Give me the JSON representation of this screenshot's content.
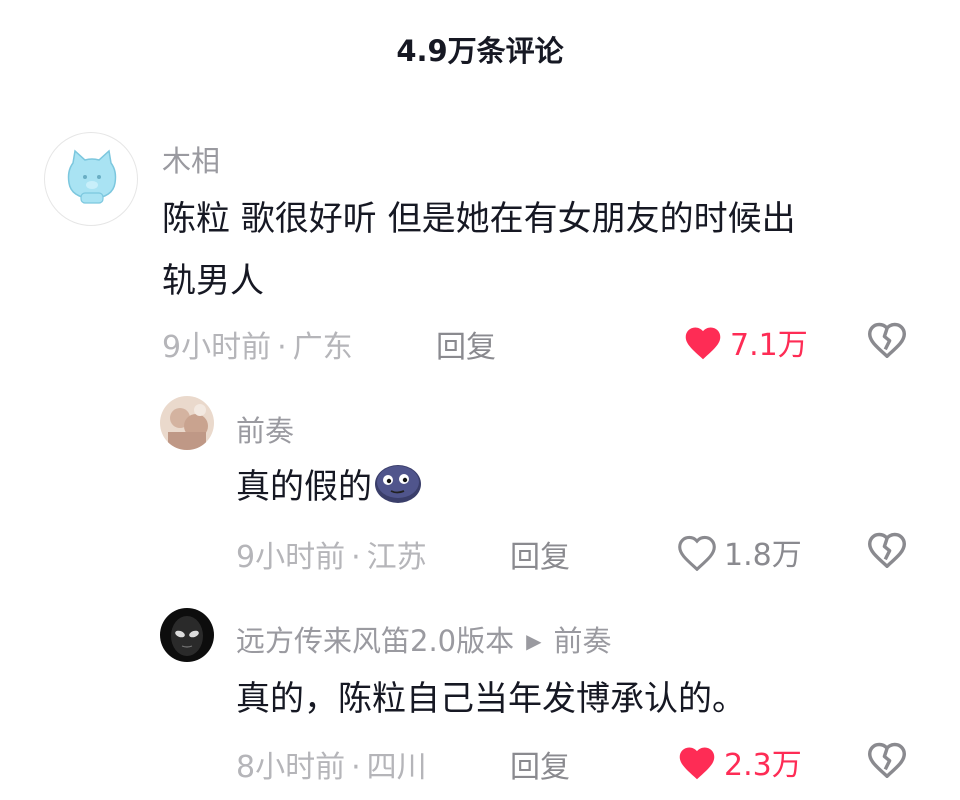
{
  "header": {
    "title": "4.9万条评论"
  },
  "comments": [
    {
      "username": "木相",
      "text_line1": "陈粒 歌很好听 但是她在有女朋友的时候出",
      "text_line2": "轨男人",
      "time": "9小时前",
      "location": "广东",
      "reply_label": "回复",
      "likes": "7.1万",
      "liked": true,
      "avatar_icon": "cat-avatar-icon"
    },
    {
      "username": "前奏",
      "text": "真的假的",
      "emoji": "moon-face-emoji-icon",
      "time": "9小时前",
      "location": "江苏",
      "reply_label": "回复",
      "likes": "1.8万",
      "liked": false,
      "avatar_icon": "photo-avatar"
    },
    {
      "username": "远方传来风笛2.0版本",
      "reply_to": "前奏",
      "text": "真的，陈粒自己当年发博承认的。",
      "time": "8小时前",
      "location": "四川",
      "reply_label": "回复",
      "likes": "2.3万",
      "liked": true,
      "avatar_icon": "dark-face-avatar"
    }
  ],
  "colors": {
    "like_red": "#fe2c55",
    "text_primary": "#161823",
    "text_secondary": "#9a9aa0"
  }
}
